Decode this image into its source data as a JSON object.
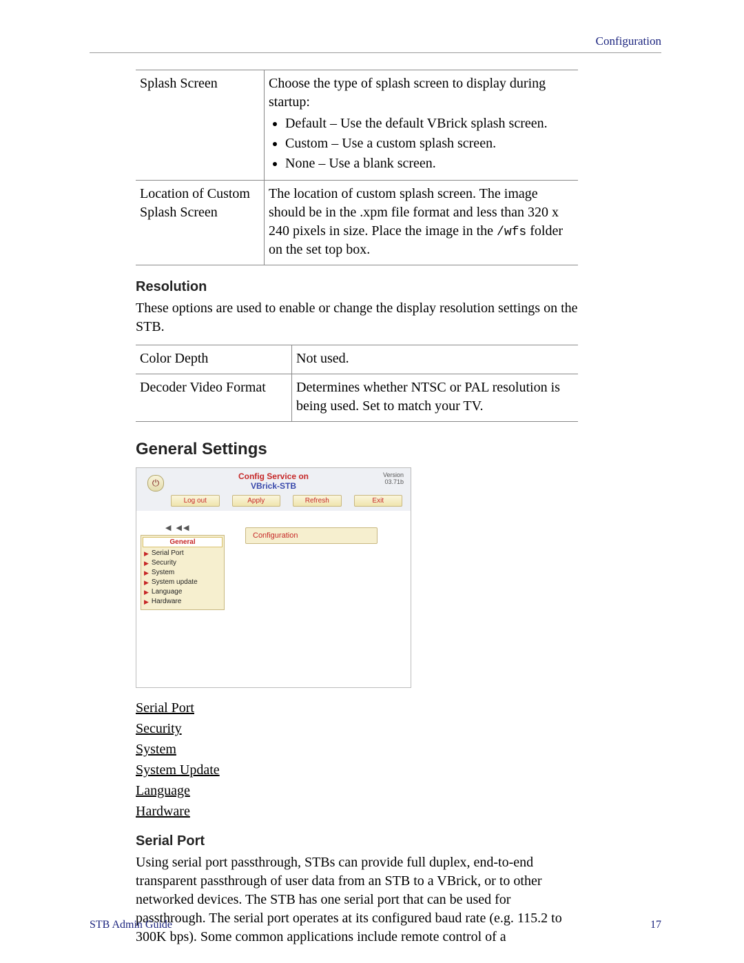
{
  "header_link": "Configuration",
  "table1": {
    "row1": {
      "label": "Splash Screen",
      "intro": "Choose the type of splash screen to display during startup:",
      "bullets": [
        "Default – Use the default VBrick splash screen.",
        "Custom – Use a custom splash screen.",
        "None – Use a blank screen."
      ]
    },
    "row2": {
      "label": "Location of Custom Splash Screen",
      "desc_a": "The location of custom splash screen. The image should be in the .xpm file format and less than 320 x 240 pixels in size. Place the image in the ",
      "code": "/wfs",
      "desc_b": " folder on the set top box."
    }
  },
  "resolution": {
    "heading": "Resolution",
    "intro": "These options are used to enable or change the display resolution settings on the STB.",
    "r1label": "Color Depth",
    "r1val": "Not used.",
    "r2label": "Decoder Video Format",
    "r2val": "Determines whether NTSC or PAL resolution is being used. Set to match your TV."
  },
  "general": {
    "heading": "General Settings"
  },
  "shot": {
    "title_line1": "Config Service on",
    "title_line2": "VBrick-STB",
    "version_label": "Version",
    "version_value": "03.71b",
    "buttons": [
      "Log out",
      "Apply",
      "Refresh",
      "Exit"
    ],
    "menu_selected": "General",
    "menu_items": [
      "Serial Port",
      "Security",
      "System",
      "System update",
      "Language",
      "Hardware"
    ],
    "content_box": "Configuration"
  },
  "subsection_links": [
    "Serial Port",
    "Security",
    "System",
    "System Update",
    "Language",
    "Hardware"
  ],
  "serialport": {
    "heading": "Serial Port",
    "body": "Using serial port passthrough, STBs can provide full duplex, end-to-end transparent passthrough of user data from an STB to a VBrick, or to other networked devices. The STB has one serial port that can be used for passthrough. The serial port operates at its configured baud rate (e.g. 115.2 to 300K bps). Some common applications include remote control of a"
  },
  "footer_left": "STB Admin Guide",
  "footer_right": "17"
}
